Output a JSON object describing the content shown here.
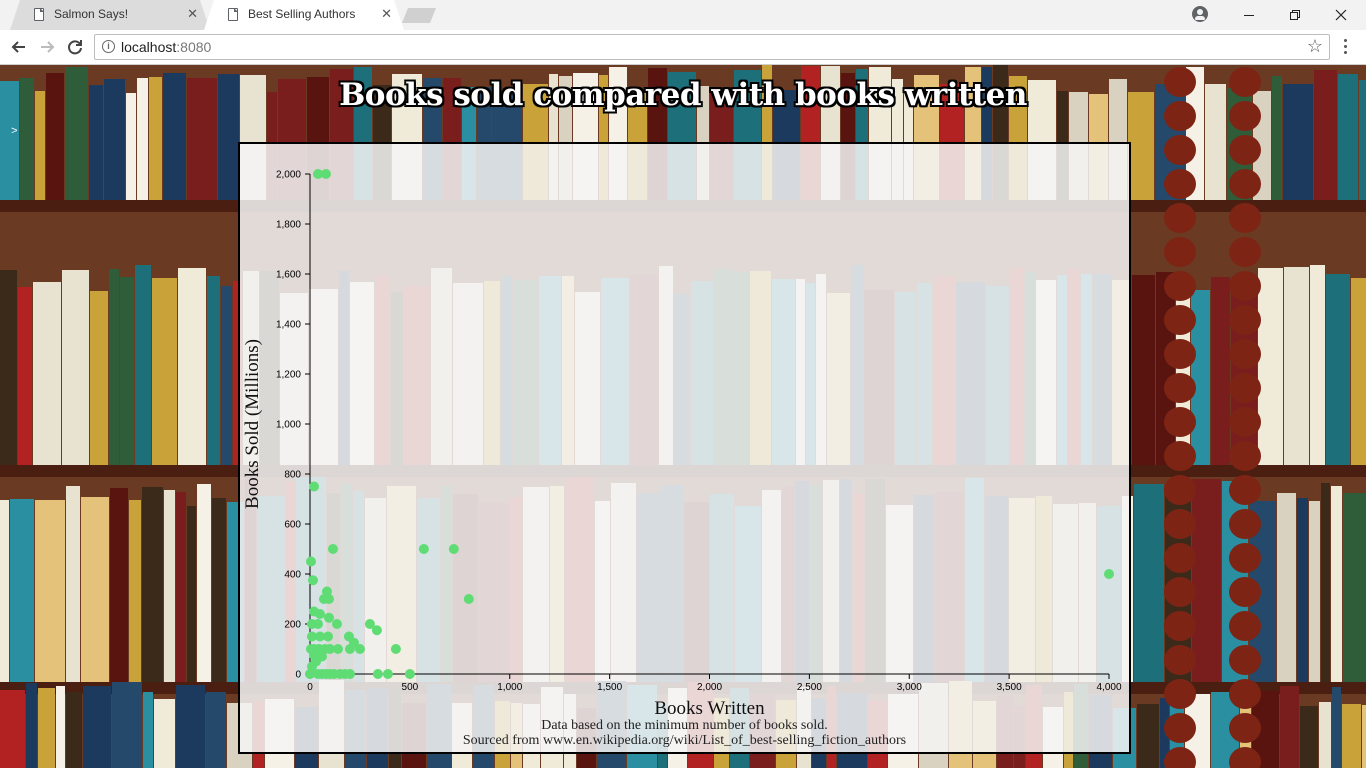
{
  "browser": {
    "tabs": [
      {
        "title": "Salmon Says!",
        "active": false
      },
      {
        "title": "Best Selling Authors",
        "active": true
      }
    ],
    "close_glyph": "✕",
    "url_host": "localhost",
    "url_port": ":8080"
  },
  "page": {
    "title": "Books sold compared with books written",
    "caret": ">",
    "note_line1": "Data based on the minimum number of books sold.",
    "note_line2": "Sourced from www.en.wikipedia.org/wiki/List_of_best-selling_fiction_authors"
  },
  "colors": {
    "point": "#5fdc74",
    "panel_border": "#000000"
  },
  "chart_data": {
    "type": "scatter",
    "title": "",
    "xlabel": "Books Written",
    "ylabel": "Books Sold (Millions)",
    "xlim": [
      0,
      4000
    ],
    "ylim": [
      0,
      2000
    ],
    "x_ticks": [
      "0",
      "500",
      "1,000",
      "1,500",
      "2,000",
      "2,500",
      "3,000",
      "3,500",
      "4,000"
    ],
    "y_ticks": [
      "0",
      "200",
      "400",
      "600",
      "800",
      "1,000",
      "1,200",
      "1,400",
      "1,600",
      "1,800",
      "2,000"
    ],
    "grid": false,
    "points": [
      {
        "x": 40,
        "y": 2000
      },
      {
        "x": 80,
        "y": 2000
      },
      {
        "x": 20,
        "y": 750
      },
      {
        "x": 115,
        "y": 500
      },
      {
        "x": 570,
        "y": 500
      },
      {
        "x": 720,
        "y": 500
      },
      {
        "x": 4000,
        "y": 400
      },
      {
        "x": 5,
        "y": 450
      },
      {
        "x": 15,
        "y": 375
      },
      {
        "x": 795,
        "y": 300
      },
      {
        "x": 70,
        "y": 300
      },
      {
        "x": 85,
        "y": 330
      },
      {
        "x": 95,
        "y": 300
      },
      {
        "x": 20,
        "y": 250
      },
      {
        "x": 50,
        "y": 240
      },
      {
        "x": 95,
        "y": 225
      },
      {
        "x": 10,
        "y": 200
      },
      {
        "x": 40,
        "y": 200
      },
      {
        "x": 135,
        "y": 200
      },
      {
        "x": 300,
        "y": 200
      },
      {
        "x": 335,
        "y": 175
      },
      {
        "x": 10,
        "y": 150
      },
      {
        "x": 50,
        "y": 150
      },
      {
        "x": 90,
        "y": 150
      },
      {
        "x": 195,
        "y": 150
      },
      {
        "x": 220,
        "y": 125
      },
      {
        "x": 5,
        "y": 100
      },
      {
        "x": 20,
        "y": 100
      },
      {
        "x": 45,
        "y": 100
      },
      {
        "x": 75,
        "y": 100
      },
      {
        "x": 100,
        "y": 100
      },
      {
        "x": 140,
        "y": 100
      },
      {
        "x": 200,
        "y": 100
      },
      {
        "x": 250,
        "y": 100
      },
      {
        "x": 430,
        "y": 100
      },
      {
        "x": 20,
        "y": 75
      },
      {
        "x": 60,
        "y": 70
      },
      {
        "x": 30,
        "y": 50
      },
      {
        "x": 10,
        "y": 30
      },
      {
        "x": 0,
        "y": 0
      },
      {
        "x": 40,
        "y": 0
      },
      {
        "x": 60,
        "y": 0
      },
      {
        "x": 80,
        "y": 0
      },
      {
        "x": 100,
        "y": 0
      },
      {
        "x": 120,
        "y": 0
      },
      {
        "x": 150,
        "y": 0
      },
      {
        "x": 175,
        "y": 0
      },
      {
        "x": 200,
        "y": 0
      },
      {
        "x": 340,
        "y": 0
      },
      {
        "x": 390,
        "y": 0
      },
      {
        "x": 500,
        "y": 0
      }
    ]
  }
}
